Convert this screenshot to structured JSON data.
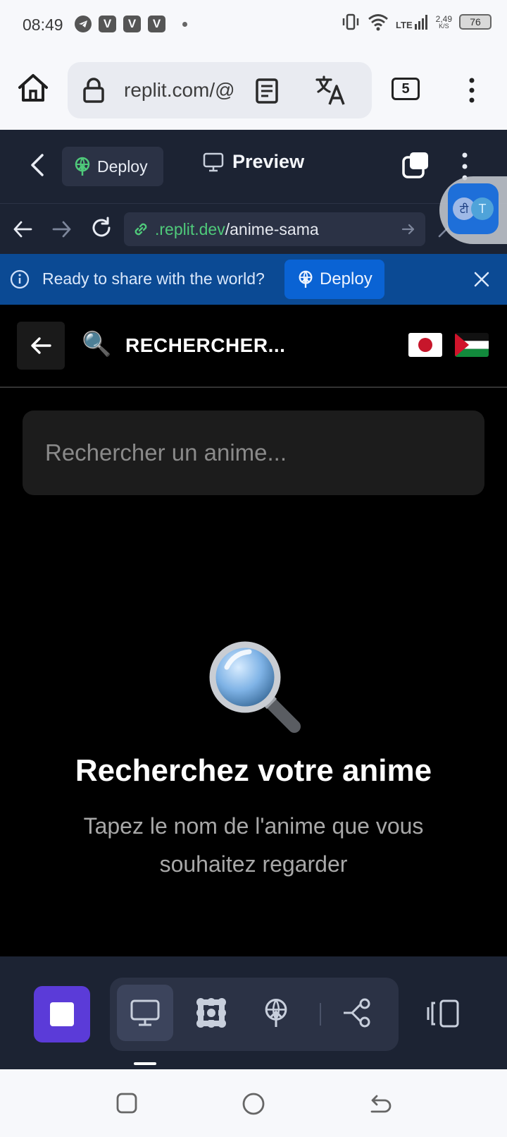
{
  "status_bar": {
    "time": "08:49",
    "network": "LTE",
    "data_rate": "2,49",
    "data_rate_unit": "K/S",
    "battery": "76"
  },
  "browser": {
    "url_display": "replit.com/@",
    "tab_count": "5"
  },
  "replit_header": {
    "deploy_label": "Deploy",
    "preview_label": "Preview"
  },
  "webview": {
    "url_domain": ".replit.dev",
    "url_path": "/anime-sama"
  },
  "banner": {
    "message": "Ready to share with the world?",
    "deploy_label": "Deploy"
  },
  "app": {
    "title": "RECHERCHER...",
    "title_icon": "🔍",
    "search_placeholder": "Rechercher un anime...",
    "empty_title": "Recherchez votre anime",
    "empty_subtitle": "Tapez le nom de l'anime que vous souhaitez regarder"
  },
  "translate_bubble": {
    "glyph_hindi": "टी",
    "glyph_latin": "T"
  },
  "colors": {
    "replit_bg": "#1c2333",
    "replit_panel": "#2b3245",
    "banner_bg": "#0b4a94",
    "banner_button": "#0a63d4",
    "stop_button": "#5b3bd8",
    "url_green": "#4fc97a"
  }
}
